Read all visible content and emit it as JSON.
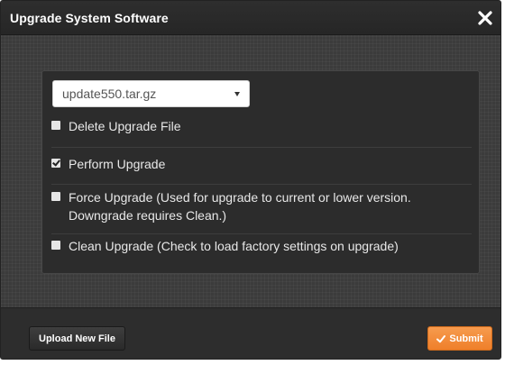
{
  "dialog": {
    "title": "Upgrade System Software",
    "close_icon": "close-x-icon"
  },
  "file_select": {
    "selected": "update550.tar.gz",
    "icon": "dropdown-caret-icon"
  },
  "options": [
    {
      "label": "Delete Upgrade File",
      "checked": false
    },
    {
      "label": "Perform Upgrade",
      "checked": true
    },
    {
      "label": "Force Upgrade (Used for upgrade to current or lower version. Downgrade requires Clean.)",
      "checked": false
    },
    {
      "label": "Clean Upgrade (Check to load factory settings on upgrade)",
      "checked": false
    }
  ],
  "footer": {
    "upload_label": "Upload New File",
    "submit_label": "Submit",
    "submit_icon": "checkmark-icon"
  },
  "colors": {
    "accent": "#f08a35",
    "background": "#3a3a3a",
    "panel": "#2c2c2c"
  }
}
